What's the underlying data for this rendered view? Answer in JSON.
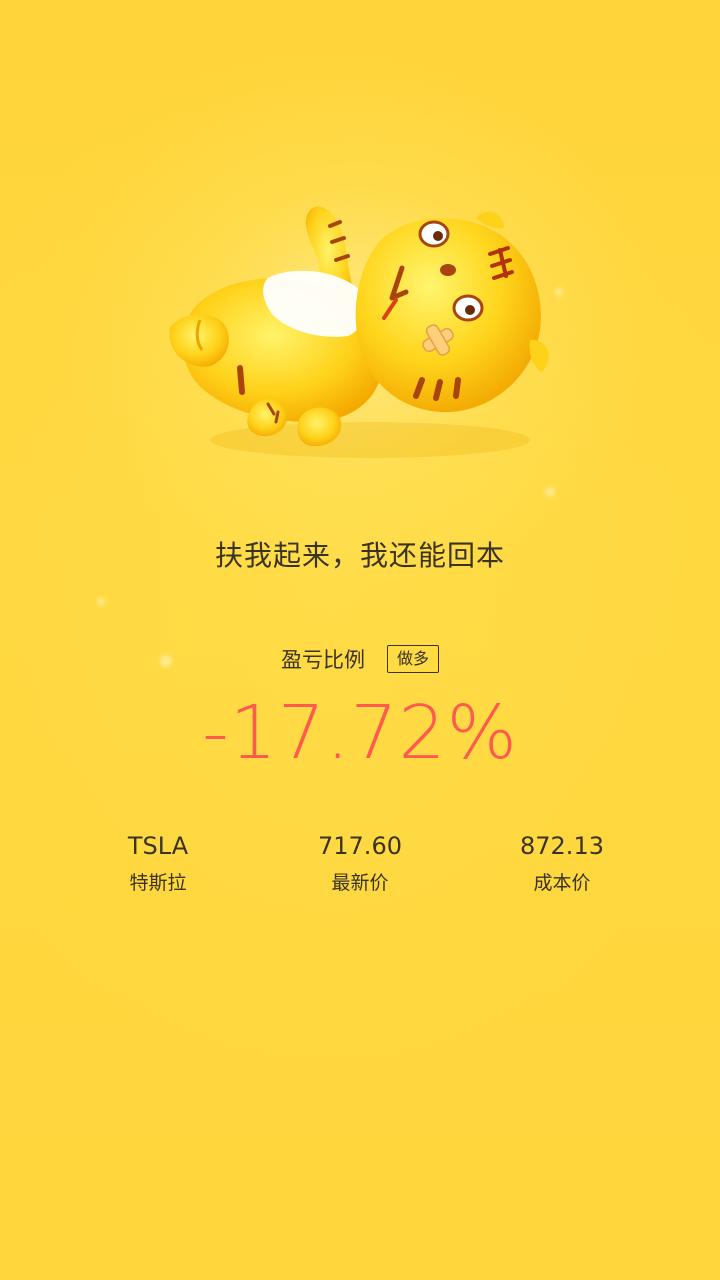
{
  "mascot": {
    "name": "tiger-mascot-lying-down"
  },
  "slogan": "扶我起来，我还能回本",
  "ratio": {
    "label": "盈亏比例",
    "direction": "做多",
    "value": "-17.72%",
    "color": "#ff5a4e"
  },
  "stock": {
    "symbol": "TSLA",
    "name": "特斯拉",
    "latest_price": "717.60",
    "latest_price_label": "最新价",
    "cost_price": "872.13",
    "cost_price_label": "成本价"
  },
  "colors": {
    "background": "#ffd93f",
    "text": "#3a3320",
    "loss": "#ff5a4e"
  }
}
